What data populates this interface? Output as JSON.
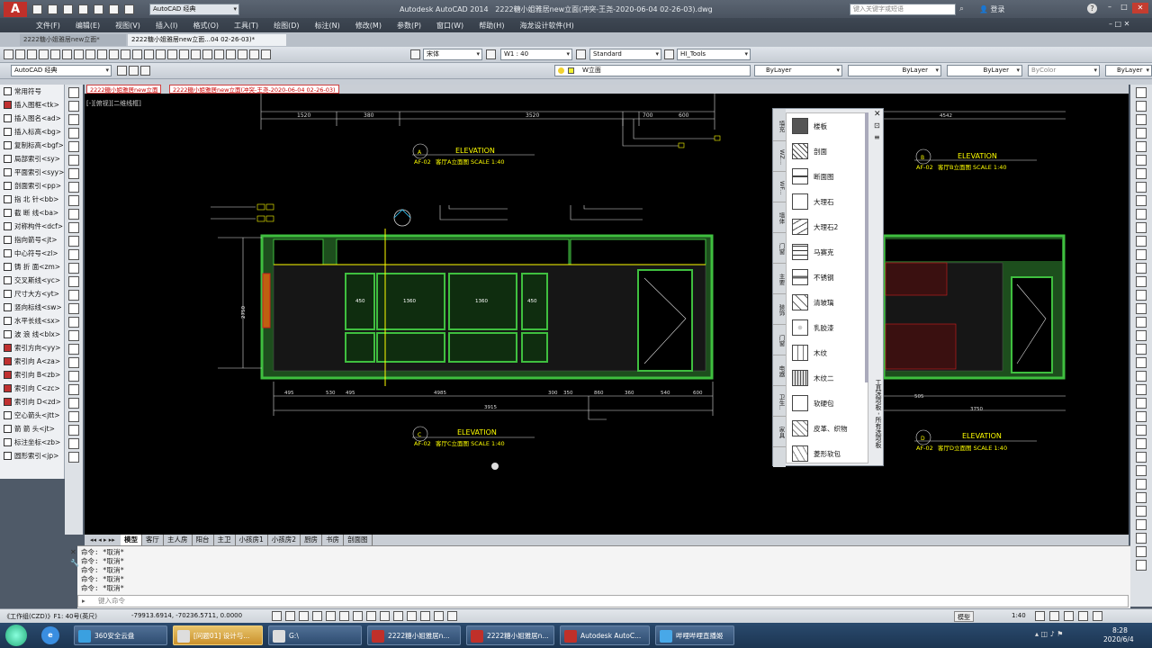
{
  "title_bar": {
    "app_title": "Autodesk AutoCAD 2014",
    "doc_title": "2222糖小姐雅居new立面(冲突-王尧-2020-06-04 02-26-03).dwg",
    "workspace": "AutoCAD 经典",
    "search_placeholder": "键入关键字或短语",
    "login": "登录"
  },
  "menu": [
    "文件(F)",
    "编辑(E)",
    "视图(V)",
    "插入(I)",
    "格式(O)",
    "工具(T)",
    "绘图(D)",
    "标注(N)",
    "修改(M)",
    "参数(P)",
    "窗口(W)",
    "帮助(H)",
    "海龙设计软件(H)"
  ],
  "file_tabs": [
    "2222糖小姐雅居new立面*",
    "2222糖小姐雅居new立面...04 02-26-03)*"
  ],
  "toolbar": {
    "text_style": "宋体",
    "dim_style": "W1 : 40",
    "table_style": "Standard",
    "multileader": "HI_Tools",
    "workspace_combo": "AutoCAD 经典",
    "layer": "W立面",
    "color": "ByLayer",
    "linetype": "ByLayer",
    "lineweight": "ByLayer",
    "plotstyle": "ByColor",
    "last": "ByLayer"
  },
  "doc_tabs": [
    "2222糖小姐雅居new立面",
    "2222糖小姐雅居new立面(冲突-王尧-2020-06-04 02-26-03)"
  ],
  "viewport_label": "[-][俯视][二维线框]",
  "left_palette": [
    "常用符号",
    "插入图框<tk>",
    "插入图名<ad>",
    "插入标高<bg>",
    "复制标高<bgf>",
    "局部索引<sy>",
    "平面索引<syy>",
    "剖面索引<pp>",
    "指 北 针<bb>",
    "截 断 线<ba>",
    "对称构件<dcf>",
    "指向箭号<jt>",
    "中心符号<zl>",
    "铸 折 面<zm>",
    "交叉斯线<yc>",
    "尺寸大方<yt>",
    "竖向标线<sw>",
    "水平长线<sx>",
    "波 浪 线<blx>",
    "索引方向<yy>",
    "索引向 A<za>",
    "索引向 B<zb>",
    "索引向 C<zc>",
    "索引向 D<zd>",
    "空心箭头<jtt>",
    "箭 箭 头<jt>",
    "标注坐标<zb>",
    "圆形索引<jp>"
  ],
  "elevations": {
    "a": {
      "letter": "A",
      "heading": "ELEVATION",
      "code": "AF-02",
      "subtitle": "客厅A立面图 SCALE 1:40"
    },
    "b": {
      "letter": "B",
      "heading": "ELEVATION",
      "code": "AF-02",
      "subtitle": "客厅B立面图 SCALE 1:40"
    },
    "c": {
      "letter": "C",
      "heading": "ELEVATION",
      "code": "AF-02",
      "subtitle": "客厅C立面图 SCALE 1:40"
    },
    "d": {
      "letter": "D",
      "heading": "ELEVATION",
      "code": "AF-02",
      "subtitle": "客厅D立面图 SCALE 1:40"
    }
  },
  "dims": {
    "top": [
      "1520",
      "380",
      "3520",
      "700",
      "600"
    ],
    "panels": [
      "450",
      "1360",
      "1360",
      "450"
    ],
    "bottom": [
      "495",
      "530",
      "495",
      "4985",
      "300",
      "350",
      "860",
      "360",
      "540",
      "600"
    ],
    "total": "3915",
    "height": "2750",
    "b_top": "4542",
    "b_bottom": [
      "505",
      "3750"
    ]
  },
  "tool_palette": {
    "title": "工具选项板 - 所有选项板",
    "items": [
      "楼板",
      "剖面",
      "断面图",
      "大理石",
      "大理石2",
      "马赛克",
      "不锈钢",
      "清玻璃",
      "乳胶漆",
      "木纹",
      "木纹二",
      "软硬包",
      "皮革、织物",
      "菱形软包"
    ],
    "tabs": [
      "填充",
      "WZ...",
      "WF...",
      "墙体",
      "门窗",
      "主要",
      "装饰",
      "门窗",
      "电器",
      "卫生..",
      "家具"
    ]
  },
  "layout_tabs": [
    "模型",
    "客厅",
    "主人房",
    "阳台",
    "主卫",
    "小孩房1",
    "小孩房2",
    "厨房",
    "书房",
    "剖面图"
  ],
  "command_history": [
    "命令: *取消*",
    "命令: *取消*",
    "命令: *取消*",
    "命令: *取消*",
    "命令: *取消*"
  ],
  "command_placeholder": "键入命令",
  "status": {
    "left": "《工作组(CZD)》F1: 40号(英尺)",
    "coords": "-79913.6914, -70236.5711, 0.0000",
    "model": "模型",
    "scale": "1:40"
  },
  "taskbar": {
    "items": [
      "360安全云盘",
      "[问题01] 设计与...",
      "G:\\",
      "2222糖小姐雅居n...",
      "2222糖小姐雅居n...",
      "Autodesk AutoC...",
      "哔哩哔哩直播姬"
    ],
    "time": "8:28",
    "date": "2020/6/4"
  },
  "colors": {
    "canvas": "#000000",
    "green": "#3fbf3f",
    "yellow": "#ffff00",
    "white": "#ffffff",
    "red": "#d02020",
    "blue_task": "#2e4c70"
  }
}
